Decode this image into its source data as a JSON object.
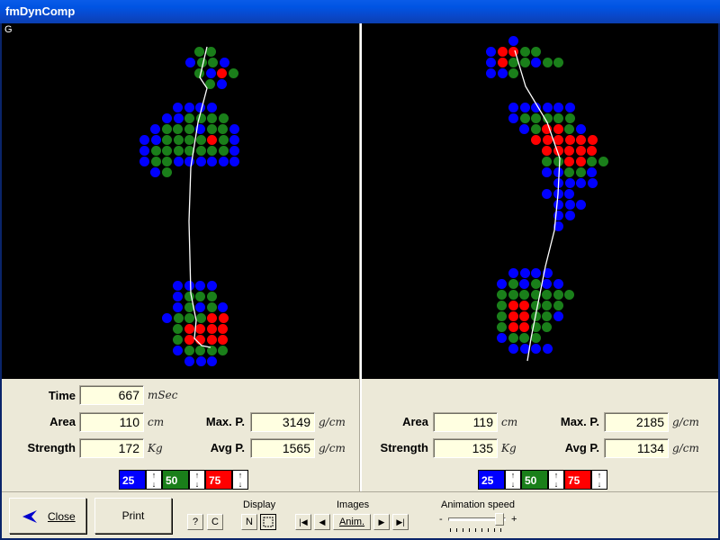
{
  "window": {
    "title": "fmDynComp"
  },
  "left": {
    "view_letter": "G",
    "time_label": "Time",
    "time_value": "667",
    "time_unit": "mSec",
    "area_label": "Area",
    "area_value": "110",
    "area_unit": "cm",
    "strength_label": "Strength",
    "strength_value": "172",
    "strength_unit": "Kg",
    "maxp_label": "Max. P.",
    "maxp_value": "3149",
    "maxp_unit": "g/cm",
    "avgp_label": "Avg P.",
    "avgp_value": "1565",
    "avgp_unit": "g/cm"
  },
  "right": {
    "area_label": "Area",
    "area_value": "119",
    "area_unit": "cm",
    "strength_label": "Strength",
    "strength_value": "135",
    "strength_unit": "Kg",
    "maxp_label": "Max. P.",
    "maxp_value": "2185",
    "maxp_unit": "g/cm",
    "avgp_label": "Avg P.",
    "avgp_value": "1134",
    "avgp_unit": "g/cm"
  },
  "legend": [
    {
      "value": "25",
      "color": "#0000ff"
    },
    {
      "value": "50",
      "color": "#1a7f1a"
    },
    {
      "value": "75",
      "color": "#ff0000"
    }
  ],
  "toolbar": {
    "close_label": "Close",
    "print_label": "Print",
    "help_label": "?",
    "c_label": "C",
    "display_title": "Display",
    "display_n": "N",
    "images_title": "Images",
    "first_label": "|◀",
    "prev_label": "◀",
    "anim_label": "Anim.",
    "next_label": "▶",
    "last_label": "▶|",
    "speed_title": "Animation speed",
    "speed_minus": "-",
    "speed_plus": "+"
  }
}
